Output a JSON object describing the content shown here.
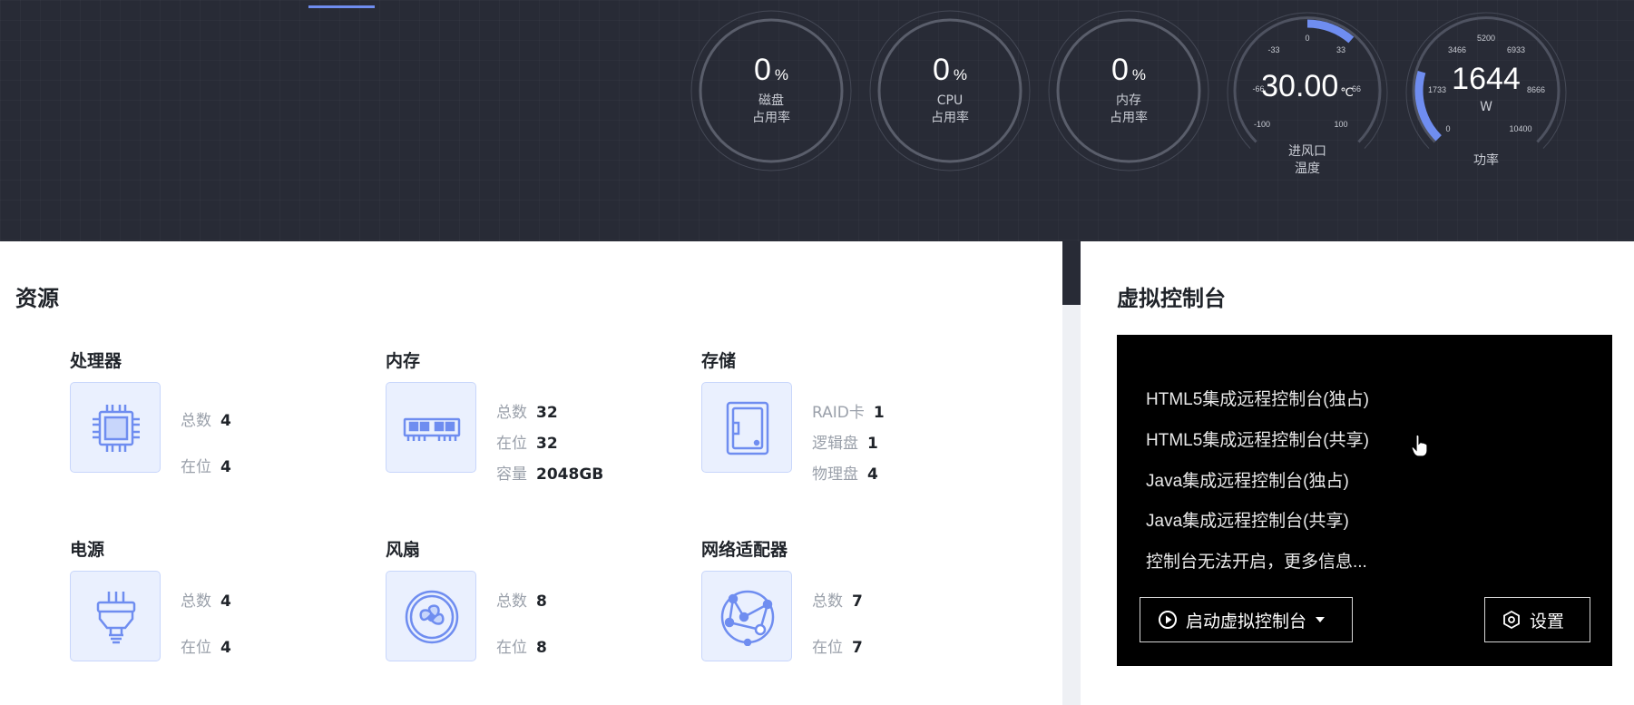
{
  "header": {
    "gauges": [
      {
        "value": "0",
        "unit": "%",
        "label1": "磁盘",
        "label2": "占用率"
      },
      {
        "value": "0",
        "unit": "%",
        "label1": "CPU",
        "label2": "占用率"
      },
      {
        "value": "0",
        "unit": "%",
        "label1": "内存",
        "label2": "占用率"
      }
    ],
    "temperature": {
      "value": "30.00",
      "unit": "℃",
      "label1": "进风口",
      "label2": "温度",
      "ticks": [
        "-100",
        "-66",
        "-33",
        "0",
        "33",
        "66",
        "100"
      ]
    },
    "power": {
      "value": "1644",
      "unit": "W",
      "label": "功率",
      "ticks": [
        "0",
        "1733",
        "3466",
        "5200",
        "6933",
        "8666",
        "10400"
      ]
    },
    "colors": {
      "accent": "#6f8df0",
      "header_bg": "#282b36"
    }
  },
  "resources": {
    "title": "资源",
    "items": [
      {
        "name": "处理器",
        "icon": "processor-icon",
        "stats": [
          {
            "label": "总数",
            "value": "4"
          },
          {
            "label": "在位",
            "value": "4"
          }
        ]
      },
      {
        "name": "内存",
        "icon": "memory-icon",
        "stats": [
          {
            "label": "总数",
            "value": "32"
          },
          {
            "label": "在位",
            "value": "32"
          },
          {
            "label": "容量",
            "value": "2048GB"
          }
        ]
      },
      {
        "name": "存储",
        "icon": "storage-icon",
        "stats": [
          {
            "label": "RAID卡",
            "value": "1"
          },
          {
            "label": "逻辑盘",
            "value": "1"
          },
          {
            "label": "物理盘",
            "value": "4"
          }
        ]
      },
      {
        "name": "电源",
        "icon": "power-supply-icon",
        "stats": [
          {
            "label": "总数",
            "value": "4"
          },
          {
            "label": "在位",
            "value": "4"
          }
        ]
      },
      {
        "name": "风扇",
        "icon": "fan-icon",
        "stats": [
          {
            "label": "总数",
            "value": "8"
          },
          {
            "label": "在位",
            "value": "8"
          }
        ]
      },
      {
        "name": "网络适配器",
        "icon": "network-adapter-icon",
        "stats": [
          {
            "label": "总数",
            "value": "7"
          },
          {
            "label": "在位",
            "value": "7"
          }
        ]
      }
    ]
  },
  "virtual_console": {
    "title": "虚拟控制台",
    "links": [
      "HTML5集成远程控制台(独占)",
      "HTML5集成远程控制台(共享)",
      "Java集成远程控制台(独占)",
      "Java集成远程控制台(共享)",
      "控制台无法开启，更多信息..."
    ],
    "launch_button": "启动虚拟控制台",
    "settings_button": "设置"
  }
}
